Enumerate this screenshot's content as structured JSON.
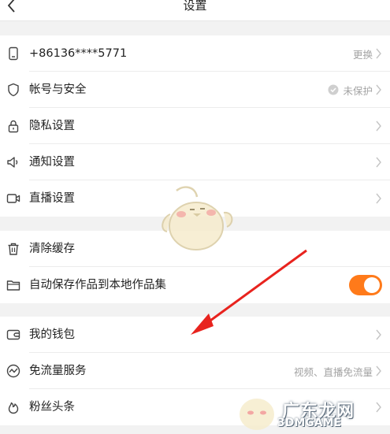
{
  "header": {
    "title": "设置"
  },
  "group1": [
    {
      "label": "+86136****5771",
      "value": "更换",
      "icon": "phone-icon"
    },
    {
      "label": "帐号与安全",
      "value": "未保护",
      "icon": "shield-icon"
    },
    {
      "label": "隐私设置",
      "value": "",
      "icon": "lock-icon"
    },
    {
      "label": "通知设置",
      "value": "",
      "icon": "speaker-icon"
    },
    {
      "label": "直播设置",
      "value": "",
      "icon": "camera-icon"
    }
  ],
  "group2": [
    {
      "label": "清除缓存",
      "icon": "trash-icon"
    },
    {
      "label": "自动保存作品到本地作品集",
      "icon": "folder-icon",
      "toggle_on": true
    }
  ],
  "group3": [
    {
      "label": "我的钱包",
      "value": "",
      "icon": "wallet-icon"
    },
    {
      "label": "免流量服务",
      "value": "视频、直播免流量",
      "icon": "data-icon"
    },
    {
      "label": "粉丝头条",
      "value": "",
      "icon": "fire-icon"
    }
  ],
  "watermark": {
    "text": "广东龙网",
    "sub": "3DMGAME"
  },
  "colors": {
    "accent": "#ff7a1a",
    "arrow": "#e8231e"
  }
}
